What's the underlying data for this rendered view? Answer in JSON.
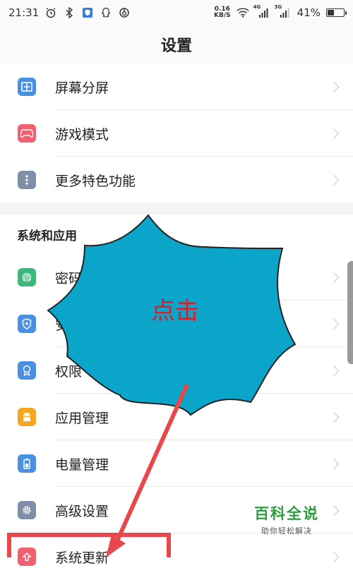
{
  "status_bar": {
    "time": "21:31",
    "net_speed_value": "0.16",
    "net_speed_unit": "KB/S",
    "signal_4g": "4G",
    "signal_3g": "3G",
    "battery_percent": "41%",
    "battery_level": 0.41
  },
  "header": {
    "title": "设置"
  },
  "top_items": [
    {
      "label": "屏幕分屏",
      "icon": "split-screen-icon",
      "color": "#4a90e2"
    },
    {
      "label": "游戏模式",
      "icon": "gamepad-icon",
      "color": "#f06070"
    },
    {
      "label": "更多特色功能",
      "icon": "more-dots-icon",
      "color": "#7f8fa6"
    }
  ],
  "system_section": {
    "title": "系统和应用",
    "items": [
      {
        "label": "密码",
        "icon": "fingerprint-icon",
        "color": "#3cb878"
      },
      {
        "label": "安",
        "icon": "shield-icon",
        "color": "#4a90e2"
      },
      {
        "label": "权限",
        "icon": "permission-icon",
        "color": "#4a90e2"
      },
      {
        "label": "应用管理",
        "icon": "android-icon",
        "color": "#f5a623"
      },
      {
        "label": "电量管理",
        "icon": "battery-icon",
        "color": "#4a90e2"
      },
      {
        "label": "高级设置",
        "icon": "gear-icon",
        "color": "#7f8fa6"
      },
      {
        "label": "系统更新",
        "icon": "update-icon",
        "color": "#f06070"
      }
    ]
  },
  "annotation": {
    "callout_text": "点击",
    "callout_color": "#0aa5c9",
    "arrow_color": "#e8474b"
  },
  "watermark": {
    "main": "百科全说",
    "sub": "助你轻松解决"
  }
}
